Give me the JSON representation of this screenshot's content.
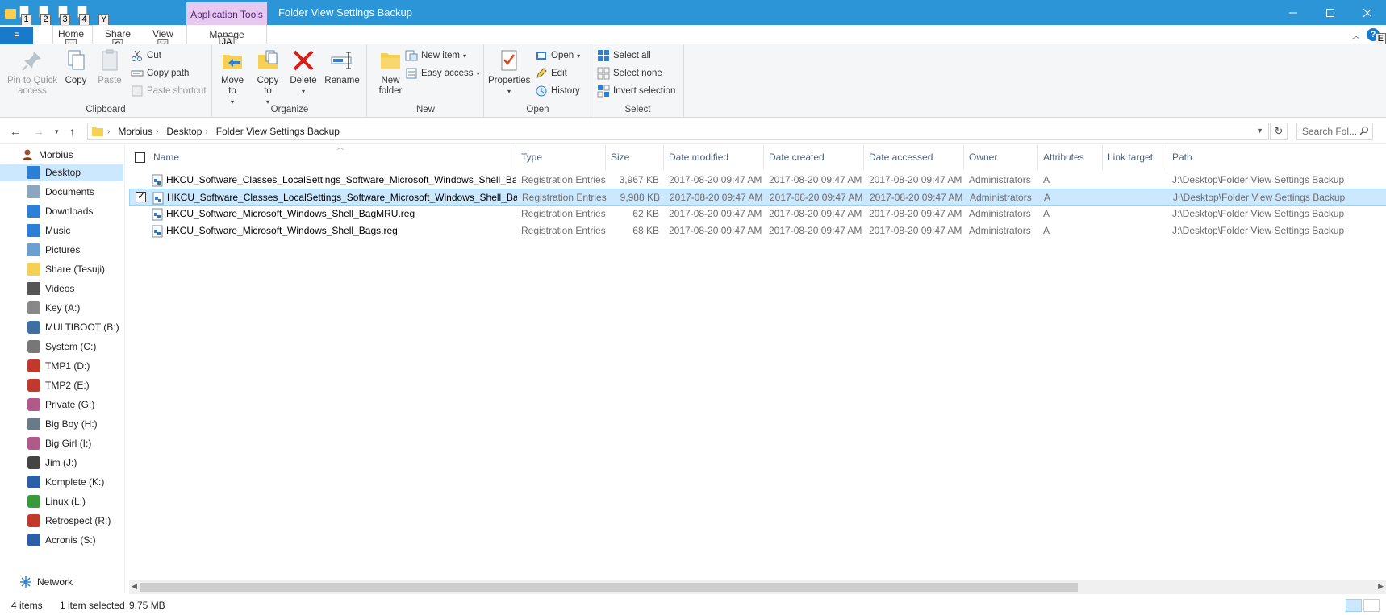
{
  "window": {
    "title": "Folder View Settings Backup",
    "context_tab": "Application Tools",
    "controls": [
      "minimize-icon",
      "maximize-icon",
      "close-icon"
    ]
  },
  "qat": {
    "keytips": [
      "1",
      "2",
      "3",
      "4",
      "Y"
    ]
  },
  "ribbon_tabs": {
    "file": "F",
    "home": {
      "label": "Home",
      "keytip": "H"
    },
    "share": {
      "label": "Share",
      "keytip": "S"
    },
    "view": {
      "label": "View",
      "keytip": "V"
    },
    "manage": {
      "label": "Manage",
      "keytip": "JA"
    },
    "right_keytip": "E"
  },
  "ribbon": {
    "clipboard": {
      "label": "Clipboard",
      "pin": "Pin to Quick access",
      "copy": "Copy",
      "paste": "Paste",
      "cut": "Cut",
      "copy_path": "Copy path",
      "paste_shortcut": "Paste shortcut"
    },
    "organize": {
      "label": "Organize",
      "move_to": "Move to",
      "copy_to": "Copy to",
      "delete": "Delete",
      "rename": "Rename"
    },
    "new": {
      "label": "New",
      "new_folder": "New folder",
      "new_item": "New item",
      "easy_access": "Easy access"
    },
    "open": {
      "label": "Open",
      "properties": "Properties",
      "open": "Open",
      "edit": "Edit",
      "history": "History"
    },
    "select": {
      "label": "Select",
      "select_all": "Select all",
      "select_none": "Select none",
      "invert": "Invert selection"
    }
  },
  "address": {
    "crumbs": [
      "Morbius",
      "Desktop",
      "Folder View Settings Backup"
    ],
    "search_placeholder": "Search Fol..."
  },
  "nav": {
    "root": "Morbius",
    "items": [
      {
        "label": "Desktop",
        "icon": "desktop-icon",
        "selected": true
      },
      {
        "label": "Documents",
        "icon": "documents-icon"
      },
      {
        "label": "Downloads",
        "icon": "downloads-icon"
      },
      {
        "label": "Music",
        "icon": "music-icon"
      },
      {
        "label": "Pictures",
        "icon": "pictures-icon"
      },
      {
        "label": "Share (Tesuji)",
        "icon": "share-folder-icon"
      },
      {
        "label": "Videos",
        "icon": "videos-icon"
      },
      {
        "label": "Key (A:)",
        "icon": "key-drive-icon"
      },
      {
        "label": "MULTIBOOT (B:)",
        "icon": "multiboot-drive-icon"
      },
      {
        "label": "System (C:)",
        "icon": "system-drive-icon"
      },
      {
        "label": "TMP1 (D:)",
        "icon": "tmp1-drive-icon"
      },
      {
        "label": "TMP2 (E:)",
        "icon": "tmp2-drive-icon"
      },
      {
        "label": "Private (G:)",
        "icon": "private-drive-icon"
      },
      {
        "label": "Big Boy (H:)",
        "icon": "bigboy-drive-icon"
      },
      {
        "label": "Big Girl (I:)",
        "icon": "biggirl-drive-icon"
      },
      {
        "label": "Jim (J:)",
        "icon": "jim-drive-icon"
      },
      {
        "label": "Komplete (K:)",
        "icon": "komplete-drive-icon"
      },
      {
        "label": "Linux (L:)",
        "icon": "linux-drive-icon"
      },
      {
        "label": "Retrospect (R:)",
        "icon": "retrospect-drive-icon"
      },
      {
        "label": "Acronis (S:)",
        "icon": "acronis-drive-icon"
      }
    ],
    "network": "Network"
  },
  "columns": {
    "name": "Name",
    "type": "Type",
    "size": "Size",
    "date_modified": "Date modified",
    "date_created": "Date created",
    "date_accessed": "Date accessed",
    "owner": "Owner",
    "attributes": "Attributes",
    "link_target": "Link target",
    "path": "Path"
  },
  "files": [
    {
      "name": "HKCU_Software_Classes_LocalSettings_Software_Microsoft_Windows_Shell_BagMRU.reg",
      "type": "Registration Entries",
      "size": "3,967 KB",
      "modified": "2017-08-20 09:47 AM",
      "created": "2017-08-20 09:47 AM",
      "accessed": "2017-08-20 09:47 AM",
      "owner": "Administrators",
      "attributes": "A",
      "link_target": "",
      "path": "J:\\Desktop\\Folder View Settings Backup",
      "selected": false
    },
    {
      "name": "HKCU_Software_Classes_LocalSettings_Software_Microsoft_Windows_Shell_Bags.reg",
      "type": "Registration Entries",
      "size": "9,988 KB",
      "modified": "2017-08-20 09:47 AM",
      "created": "2017-08-20 09:47 AM",
      "accessed": "2017-08-20 09:47 AM",
      "owner": "Administrators",
      "attributes": "A",
      "link_target": "",
      "path": "J:\\Desktop\\Folder View Settings Backup",
      "selected": true
    },
    {
      "name": "HKCU_Software_Microsoft_Windows_Shell_BagMRU.reg",
      "type": "Registration Entries",
      "size": "62 KB",
      "modified": "2017-08-20 09:47 AM",
      "created": "2017-08-20 09:47 AM",
      "accessed": "2017-08-20 09:47 AM",
      "owner": "Administrators",
      "attributes": "A",
      "link_target": "",
      "path": "J:\\Desktop\\Folder View Settings Backup",
      "selected": false
    },
    {
      "name": "HKCU_Software_Microsoft_Windows_Shell_Bags.reg",
      "type": "Registration Entries",
      "size": "68 KB",
      "modified": "2017-08-20 09:47 AM",
      "created": "2017-08-20 09:47 AM",
      "accessed": "2017-08-20 09:47 AM",
      "owner": "Administrators",
      "attributes": "A",
      "link_target": "",
      "path": "J:\\Desktop\\Folder View Settings Backup",
      "selected": false
    }
  ],
  "status": {
    "count": "4 items",
    "selection": "1 item selected",
    "selection_size": "9.75 MB"
  },
  "colors": {
    "titlebar": "#2b95d7",
    "file_tab": "#1979ca",
    "app_tools": "#e7c8f0",
    "selection": "#cce8ff"
  }
}
